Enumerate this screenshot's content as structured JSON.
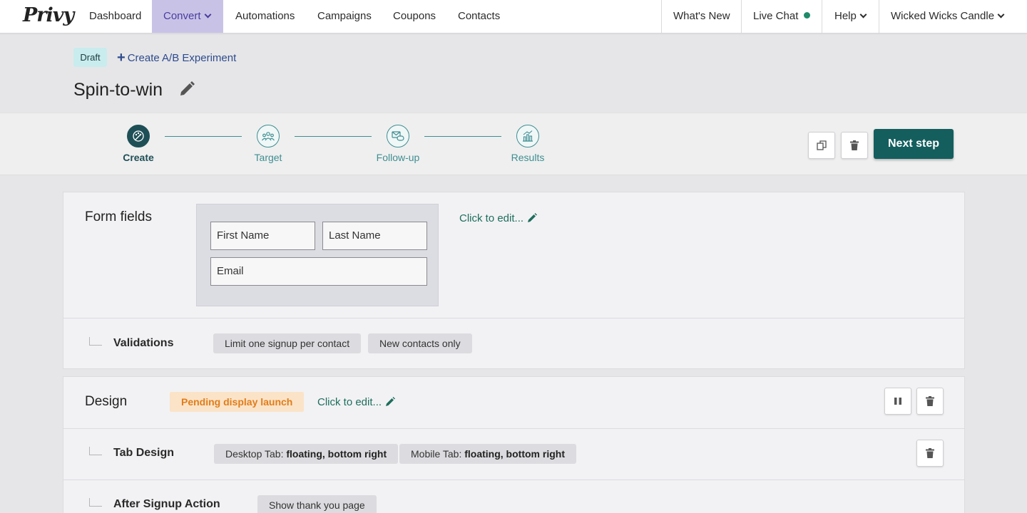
{
  "nav": {
    "logo": "Privy",
    "items": [
      {
        "label": "Dashboard"
      },
      {
        "label": "Convert"
      },
      {
        "label": "Automations"
      },
      {
        "label": "Campaigns"
      },
      {
        "label": "Coupons"
      },
      {
        "label": "Contacts"
      }
    ],
    "right": {
      "whats_new": "What's New",
      "live_chat": "Live Chat",
      "help": "Help",
      "account": "Wicked Wicks Candle"
    }
  },
  "header": {
    "status_badge": "Draft",
    "ab_link": "Create A/B Experiment",
    "title": "Spin-to-win"
  },
  "stepper": {
    "steps": [
      {
        "label": "Create",
        "active": true
      },
      {
        "label": "Target",
        "active": false
      },
      {
        "label": "Follow-up",
        "active": false
      },
      {
        "label": "Results",
        "active": false
      }
    ],
    "next_label": "Next step"
  },
  "form_fields": {
    "title": "Form fields",
    "edit_label": "Click to edit...",
    "fields": {
      "first_name": "First Name",
      "last_name": "Last Name",
      "email": "Email"
    },
    "validations": {
      "label": "Validations",
      "chips": [
        "Limit one signup per contact",
        "New contacts only"
      ]
    }
  },
  "design": {
    "title": "Design",
    "status": "Pending display launch",
    "edit_label": "Click to edit...",
    "tab_design": {
      "label": "Tab Design",
      "desktop_prefix": "Desktop Tab:",
      "desktop_value": "floating, bottom right",
      "mobile_prefix": "Mobile Tab:",
      "mobile_value": "floating, bottom right"
    },
    "after_signup": {
      "label": "After Signup Action",
      "chip": "Show thank you page"
    }
  },
  "colors": {
    "accent": "#145e5e",
    "nav_active_bg": "#c8c3e6",
    "draft_bg": "#c9ecee",
    "pending_bg": "#fbe3c8",
    "pending_text": "#e07d1a",
    "link_green": "#1e6e5c"
  }
}
